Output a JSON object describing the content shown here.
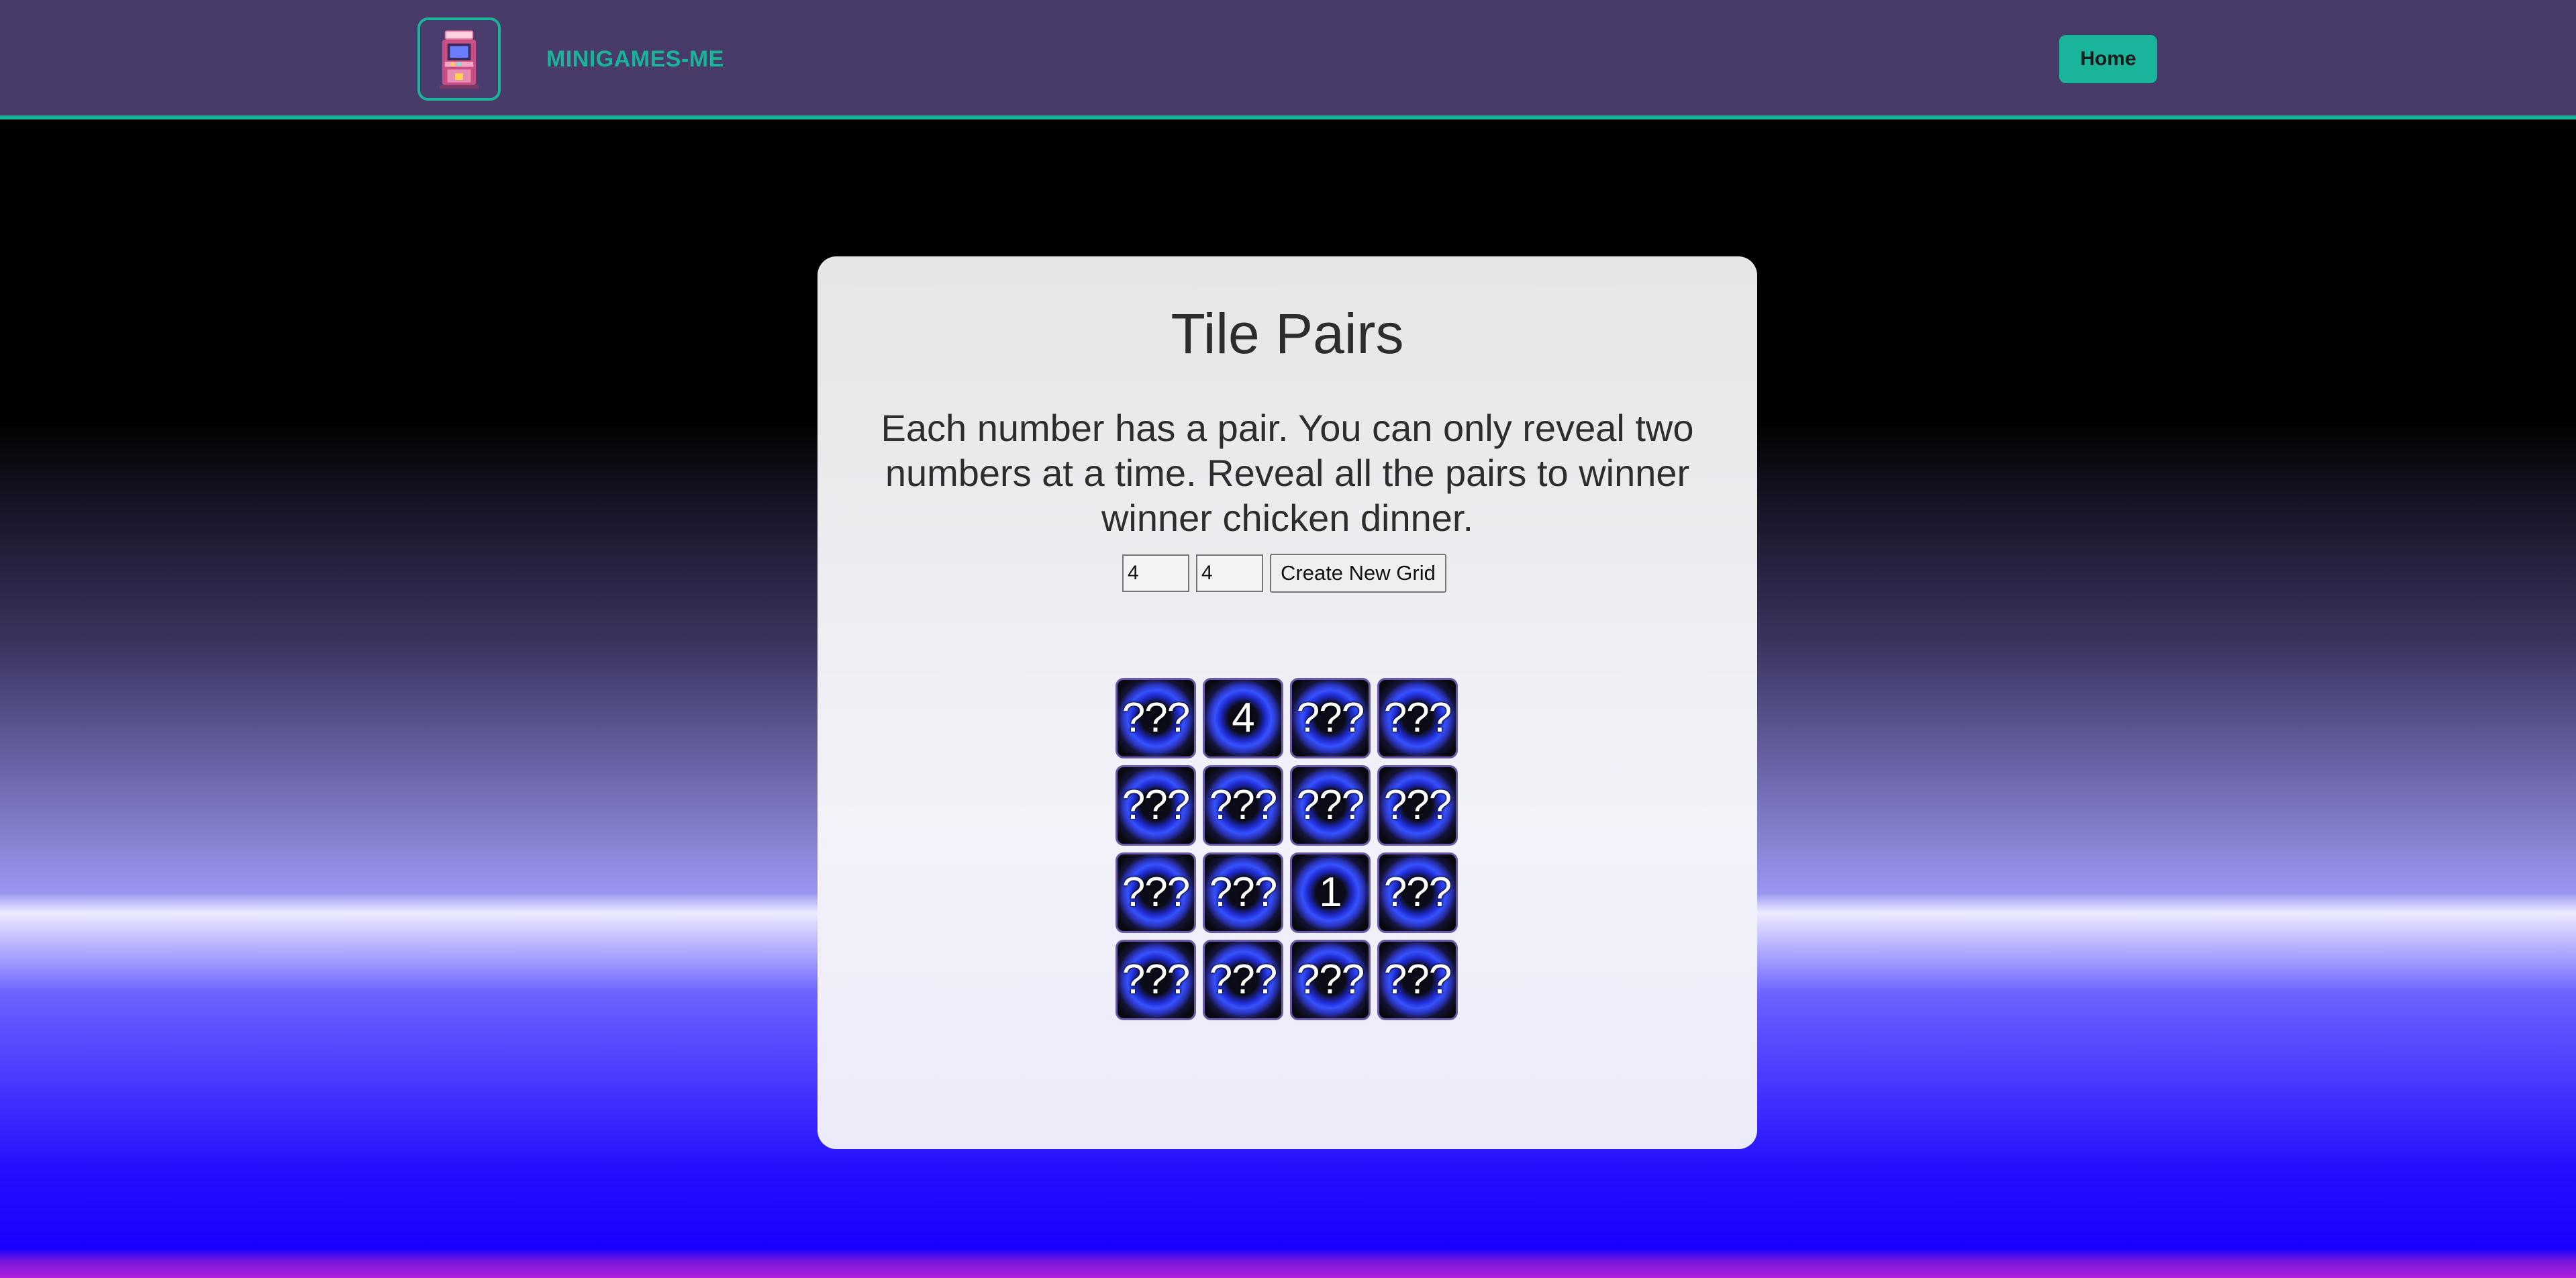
{
  "header": {
    "brand": "MINIGAMES-ME",
    "home_label": "Home",
    "logo_icon": "arcade-cabinet-icon"
  },
  "game": {
    "title": "Tile Pairs",
    "description": "Each number has a pair. You can only reveal two numbers at a time. Reveal all the pairs to winner winner chicken dinner.",
    "rows_value": "4",
    "cols_value": "4",
    "create_label": "Create New Grid"
  },
  "tiles": [
    "???",
    "4",
    "???",
    "???",
    "???",
    "???",
    "???",
    "???",
    "???",
    "???",
    "1",
    "???",
    "???",
    "???",
    "???",
    "???"
  ],
  "colors": {
    "accent": "#19b49a",
    "header_bg": "#483a69",
    "tile_glow": "#3552ff"
  }
}
